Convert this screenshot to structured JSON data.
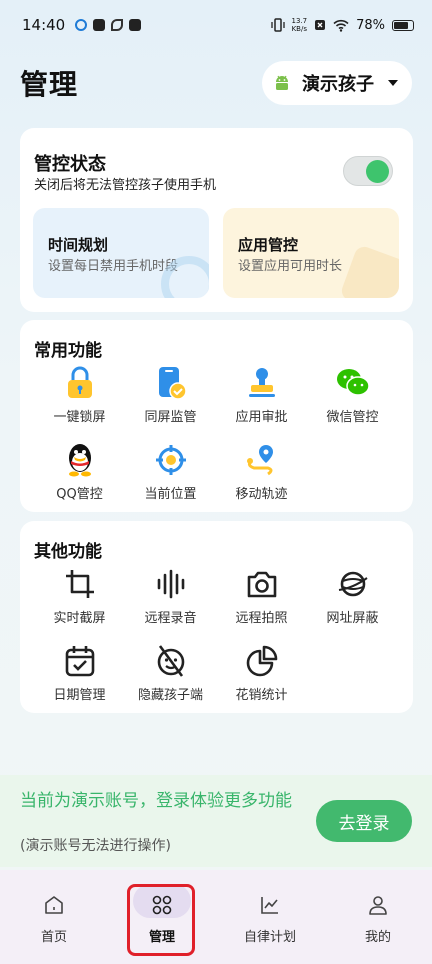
{
  "status_bar": {
    "time": "14:40",
    "net_speed_value": "13.7",
    "net_speed_unit": "KB/s",
    "battery": "78%"
  },
  "header": {
    "title": "管理",
    "child_name": "演示孩子"
  },
  "control": {
    "title": "管控状态",
    "desc": "关闭后将无法管控孩子使用手机",
    "toggle_on": true,
    "tiles": [
      {
        "title": "时间规划",
        "desc": "设置每日禁用手机时段"
      },
      {
        "title": "应用管控",
        "desc": "设置应用可用时长"
      }
    ]
  },
  "common": {
    "title": "常用功能",
    "items": [
      {
        "label": "一键锁屏",
        "icon": "lock-icon"
      },
      {
        "label": "同屏监管",
        "icon": "phone-check-icon"
      },
      {
        "label": "应用审批",
        "icon": "stamp-icon"
      },
      {
        "label": "微信管控",
        "icon": "wechat-icon"
      },
      {
        "label": "QQ管控",
        "icon": "qq-icon"
      },
      {
        "label": "当前位置",
        "icon": "location-target-icon"
      },
      {
        "label": "移动轨迹",
        "icon": "route-icon"
      }
    ]
  },
  "other": {
    "title": "其他功能",
    "items": [
      {
        "label": "实时截屏",
        "icon": "crop-icon"
      },
      {
        "label": "远程录音",
        "icon": "soundwave-icon"
      },
      {
        "label": "远程拍照",
        "icon": "camera-icon"
      },
      {
        "label": "网址屏蔽",
        "icon": "globe-block-icon"
      },
      {
        "label": "日期管理",
        "icon": "calendar-check-icon"
      },
      {
        "label": "隐藏孩子端",
        "icon": "hidden-face-icon"
      },
      {
        "label": "花销统计",
        "icon": "pie-chart-icon"
      }
    ]
  },
  "banner": {
    "main": "当前为演示账号，登录体验更多功能",
    "sub": "(演示账号无法进行操作)",
    "login_label": "去登录"
  },
  "nav": [
    {
      "label": "首页",
      "icon": "home-icon"
    },
    {
      "label": "管理",
      "icon": "apps-icon",
      "active": true
    },
    {
      "label": "自律计划",
      "icon": "chart-line-icon"
    },
    {
      "label": "我的",
      "icon": "person-icon"
    }
  ],
  "colors": {
    "accent_green": "#42b96e",
    "toggle_green": "#3ec46d",
    "highlight_red": "#e0202a"
  }
}
